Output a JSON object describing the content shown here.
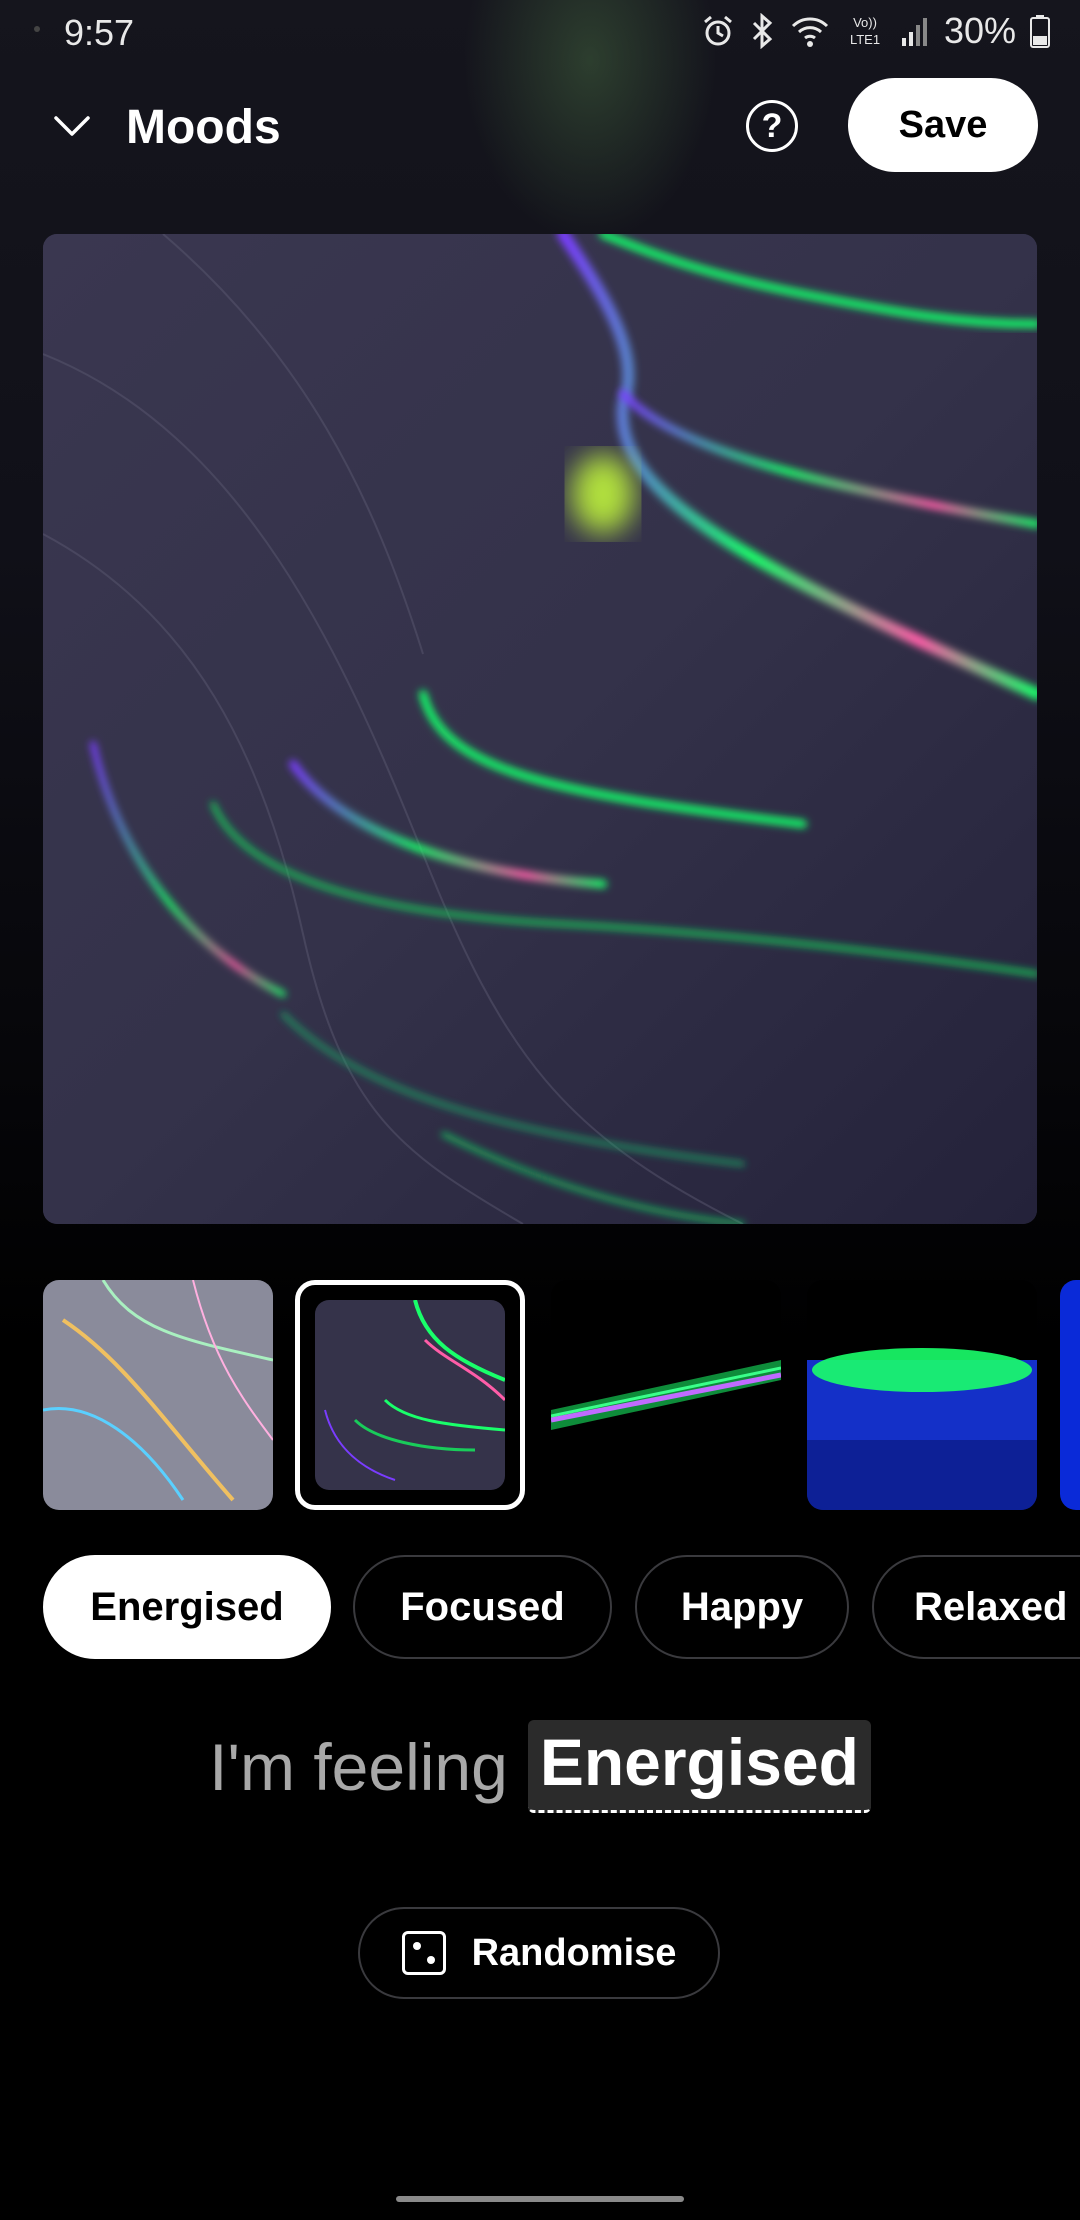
{
  "status_bar": {
    "time": "9:57",
    "battery": "30%",
    "icons": [
      "alarm-icon",
      "bluetooth-icon",
      "wifi-icon",
      "volte-icon",
      "signal-icon",
      "battery-icon"
    ],
    "volte_top": "Vo))",
    "volte_bottom": "LTE1"
  },
  "header": {
    "title": "Moods",
    "help_label": "?",
    "save_label": "Save"
  },
  "thumbnails": [
    {
      "name": "thumb-opal-light",
      "selected": false
    },
    {
      "name": "thumb-swirl-dark",
      "selected": true
    },
    {
      "name": "thumb-green-streak",
      "selected": false
    },
    {
      "name": "thumb-blue-glow",
      "selected": false
    },
    {
      "name": "thumb-partial",
      "selected": false
    }
  ],
  "moods": {
    "options": [
      "Energised",
      "Focused",
      "Happy",
      "Relaxed"
    ],
    "selected": "Energised"
  },
  "feeling": {
    "prefix": "I'm feeling",
    "value": "Energised"
  },
  "randomise": {
    "label": "Randomise",
    "icon": "dice-icon"
  },
  "colors": {
    "background": "#000000",
    "accent": "#ffffff",
    "chip_border": "#3a3a3e",
    "muted_text": "#a8a8a8"
  }
}
